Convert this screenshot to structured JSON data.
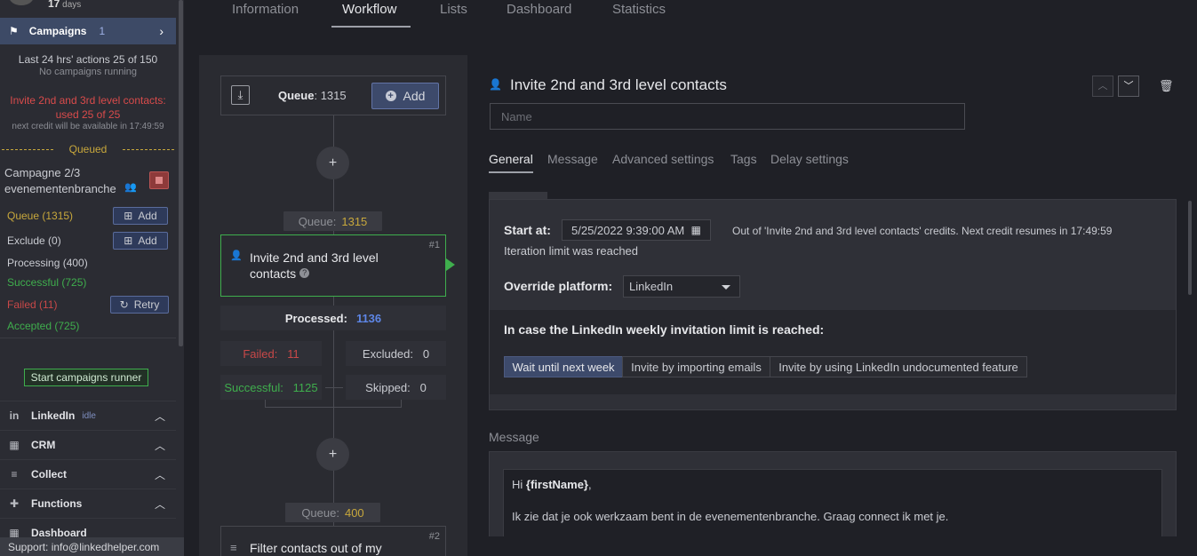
{
  "sidebar": {
    "days_value": "17",
    "days_label": "days",
    "campaigns_label": "Campaigns",
    "campaigns_count": "1",
    "actions_summary": "Last 24 hrs' actions 25 of 150",
    "no_campaigns": "No campaigns running",
    "invite_limit_line1": "Invite 2nd and 3rd level contacts:",
    "invite_limit_line2": "used 25 of 25",
    "next_credit": "next credit will be available in 17:49:59",
    "queued_label": "Queued",
    "campaign_name_line1": "Campagne 2/3",
    "campaign_name_line2": "evenementenbranche",
    "queue_row": "Queue (1315)",
    "exclude_row": "Exclude (0)",
    "processing_row": "Processing (400)",
    "successful_row": "Successful (725)",
    "failed_row": "Failed (11)",
    "accepted_row": "Accepted (725)",
    "add_label": "Add",
    "retry_label": "Retry",
    "start_runner": "Start campaigns runner",
    "sections": [
      {
        "icon": "in",
        "name": "LinkedIn",
        "status": "idle"
      },
      {
        "icon": "▦",
        "name": "CRM",
        "status": ""
      },
      {
        "icon": "≡",
        "name": "Collect",
        "status": ""
      },
      {
        "icon": "✚",
        "name": "Functions",
        "status": ""
      },
      {
        "icon": "▦",
        "name": "Dashboard",
        "status": ""
      }
    ],
    "support": "Support: info@linkedhelper.com"
  },
  "tabs": [
    "Information",
    "Workflow",
    "Lists",
    "Dashboard",
    "Statistics"
  ],
  "active_tab": "Workflow",
  "workflow": {
    "queue_label": "Queue",
    "queue_value": "1315",
    "add_label": "Add",
    "step1_queue_label": "Queue:",
    "step1_queue_value": "1315",
    "step1_title": "Invite 2nd and 3rd level contacts",
    "step1_num": "#1",
    "processed_label": "Processed:",
    "processed_value": "1136",
    "failed_label": "Failed:",
    "failed_value": "11",
    "excluded_label": "Excluded:",
    "excluded_value": "0",
    "successful_label": "Successful:",
    "successful_value": "1125",
    "skipped_label": "Skipped:",
    "skipped_value": "0",
    "step2_queue_label": "Queue:",
    "step2_queue_value": "400",
    "step2_title": "Filter contacts out of my",
    "step2_num": "#2"
  },
  "detail": {
    "title": "Invite 2nd and 3rd level contacts",
    "name_placeholder": "Name",
    "tabs": [
      "General",
      "Message",
      "Advanced settings",
      "Tags",
      "Delay settings"
    ],
    "active_tab": "General",
    "start_at_label": "Start at:",
    "start_at_value": "5/25/2022 9:39:00 AM",
    "credit_message": "Out of 'Invite 2nd and 3rd level contacts' credits. Next credit resumes in 17:49:59",
    "iteration_message": "Iteration limit was reached",
    "override_label": "Override platform:",
    "override_value": "LinkedIn",
    "limit_title": "In case the LinkedIn weekly invitation limit is reached:",
    "limit_options": [
      "Wait until next week",
      "Invite by importing emails",
      "Invite by using LinkedIn undocumented feature"
    ],
    "limit_selected": "Wait until next week",
    "message_label": "Message",
    "message_greeting": "Hi",
    "message_variable": "{firstName}",
    "message_punct": ",",
    "message_body": "Ik zie dat je ook werkzaam bent in de evenementenbranche. Graag connect ik met je."
  }
}
